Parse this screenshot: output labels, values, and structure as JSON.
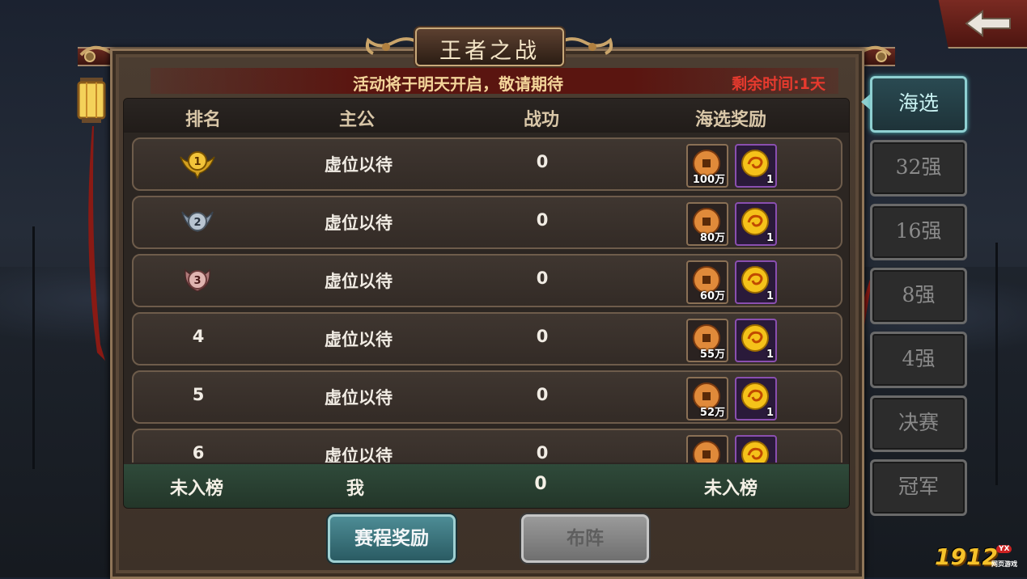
{
  "title": "王者之战",
  "notice": {
    "message": "活动将于明天开启，敬请期待",
    "remaining": "剩余时间:1天"
  },
  "table": {
    "headers": [
      "排名",
      "主公",
      "战功",
      "海选奖励"
    ],
    "rows": [
      {
        "rank": "1",
        "lord": "虚位以待",
        "power": "0",
        "coin_qty": "100万",
        "orb_qty": "1"
      },
      {
        "rank": "2",
        "lord": "虚位以待",
        "power": "0",
        "coin_qty": "80万",
        "orb_qty": "1"
      },
      {
        "rank": "3",
        "lord": "虚位以待",
        "power": "0",
        "coin_qty": "60万",
        "orb_qty": "1"
      },
      {
        "rank": "4",
        "lord": "虚位以待",
        "power": "0",
        "coin_qty": "55万",
        "orb_qty": "1"
      },
      {
        "rank": "5",
        "lord": "虚位以待",
        "power": "0",
        "coin_qty": "52万",
        "orb_qty": "1"
      },
      {
        "rank": "6",
        "lord": "虚位以待",
        "power": "0",
        "coin_qty": "",
        "orb_qty": ""
      }
    ],
    "me": {
      "rank": "未入榜",
      "lord": "我",
      "power": "0",
      "reward": "未入榜"
    }
  },
  "buttons": {
    "schedule_reward": "赛程奖励",
    "formation": "布阵"
  },
  "tabs": [
    "海选",
    "32强",
    "16强",
    "8强",
    "4强",
    "决赛",
    "冠军"
  ],
  "active_tab": "海选",
  "logo": {
    "text": "1912",
    "badge": "YX",
    "sub": "网页游戏"
  },
  "icons": [
    "back-arrow-icon",
    "lantern-icon",
    "gold-medal-icon",
    "silver-medal-icon",
    "bronze-medal-icon",
    "copper-coin-icon",
    "gold-orb-icon"
  ],
  "colors": {
    "accent_teal": "#8fd0d2",
    "notice_gold": "#f4d59a",
    "timer_red": "#e73a2e",
    "me_row_green": "#2f4a3a"
  }
}
